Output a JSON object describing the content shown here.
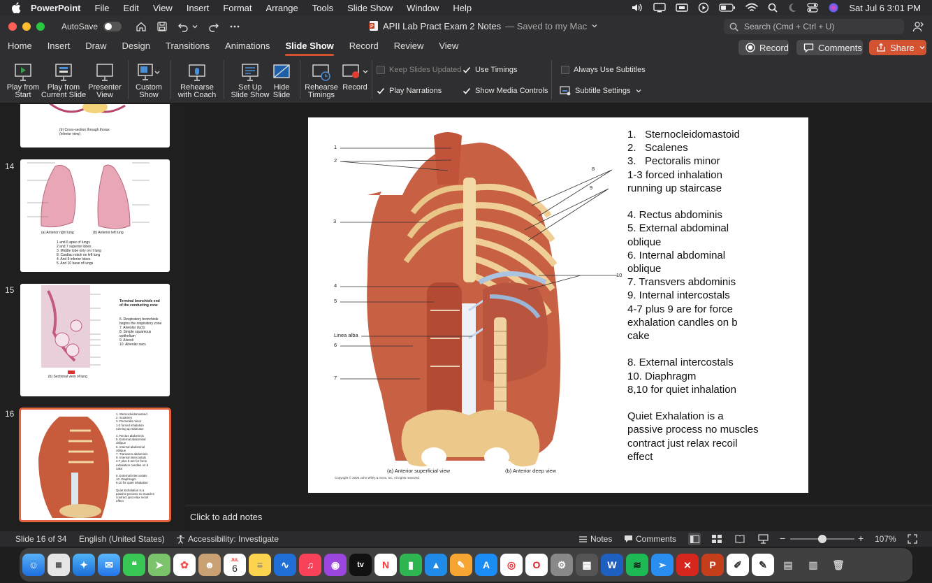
{
  "menubar": {
    "app_name": "PowerPoint",
    "items": [
      "File",
      "Edit",
      "View",
      "Insert",
      "Format",
      "Arrange",
      "Tools",
      "Slide Show",
      "Window",
      "Help"
    ],
    "datetime": "Sat Jul 6  3:01 PM"
  },
  "titlebar": {
    "autosave_label": "AutoSave",
    "doc_title": "APII Lab Pract Exam 2 Notes",
    "doc_status": "— Saved to my Mac",
    "search_placeholder": "Search (Cmd + Ctrl + U)"
  },
  "tabs": [
    "Home",
    "Insert",
    "Draw",
    "Design",
    "Transitions",
    "Animations",
    "Slide Show",
    "Record",
    "Review",
    "View"
  ],
  "active_tab": "Slide Show",
  "tab_buttons": {
    "record": "Record",
    "comments": "Comments",
    "share": "Share"
  },
  "ribbon": {
    "play_from_start": [
      "Play from",
      "Start"
    ],
    "play_from_current": [
      "Play from",
      "Current Slide"
    ],
    "presenter_view": [
      "Presenter",
      "View"
    ],
    "custom_show": [
      "Custom",
      "Show"
    ],
    "rehearse_coach": [
      "Rehearse",
      "with Coach"
    ],
    "setup_show": [
      "Set Up",
      "Slide Show"
    ],
    "hide_slide": [
      "Hide",
      "Slide"
    ],
    "rehearse_timings": [
      "Rehearse",
      "Timings"
    ],
    "record": "Record",
    "keep_slides_updated": "Keep Slides Updated",
    "use_timings": "Use Timings",
    "always_use_subtitles": "Always Use Subtitles",
    "play_narrations": "Play Narrations",
    "show_media_controls": "Show Media Controls",
    "subtitle_settings": "Subtitle Settings"
  },
  "thumbnails": {
    "t13": {
      "caption": "(b) Cross-section through thorax (inferior view)"
    },
    "t14": {
      "number": "14",
      "labels": [
        "(a) Anterior right lung",
        "(b) Anterior left lung"
      ],
      "notes": [
        "1 and 6 apex of lungs",
        "2 and 7 superior lobes",
        "3. Middle lobe only on rt lung",
        "8. Cardiac notch on left lung",
        "4. And 9 inferior lobes",
        "5. And 10 base of lungs"
      ]
    },
    "t15": {
      "number": "15",
      "title": "Terminal bronchiole end of the conducting zone",
      "notes": [
        "6. Respiratory bronchiole begins the respiratory zone",
        "7. Alveolar ducts",
        "8. Simple squamous epithelium",
        "9. Alveoli",
        "10. Alveolar sacs"
      ],
      "caption": "(b) Sectional view of lung"
    },
    "t16": {
      "number": "16"
    }
  },
  "slide": {
    "lines": [
      "1.   Sternocleidomastoid",
      "2.   Scalenes",
      "3.   Pectoralis minor",
      "1-3 forced inhalation",
      "running up staircase",
      "",
      "4. Rectus abdominis",
      "5. External abdominal",
      "oblique",
      "6. Internal abdominal",
      "oblique",
      "7. Transvers abdominis",
      "9. Internal intercostals",
      "4-7 plus 9 are for force",
      "exhalation candles on b",
      "cake",
      "",
      "8. External intercostals",
      "10. Diaphragm",
      "8,10 for quiet inhalation",
      "",
      "Quiet Exhalation is a",
      "passive process no muscles",
      "contract just relax recoil",
      "effect"
    ],
    "figure_labels": [
      "1",
      "2",
      "3",
      "4",
      "5",
      "Linea alba",
      "6",
      "7",
      "8",
      "9",
      "10"
    ],
    "caption_a": "(a) Anterior superficial view",
    "caption_b": "(b) Anterior deep view",
    "copyright": "Copyright © 2006 John Wiley & Sons, Inc.  All rights reserved."
  },
  "notes_placeholder": "Click to add notes",
  "status": {
    "slide_count": "Slide 16 of 34",
    "language": "English (United States)",
    "accessibility": "Accessibility: Investigate",
    "notes": "Notes",
    "comments": "Comments",
    "zoom": "107%"
  },
  "dock": {
    "calendar_month": "JUL",
    "calendar_day": "6"
  },
  "colors": {
    "accent": "#d35230",
    "selected_thumb_border": "#e3643c",
    "ribbon_bg": "#2f2e30"
  }
}
